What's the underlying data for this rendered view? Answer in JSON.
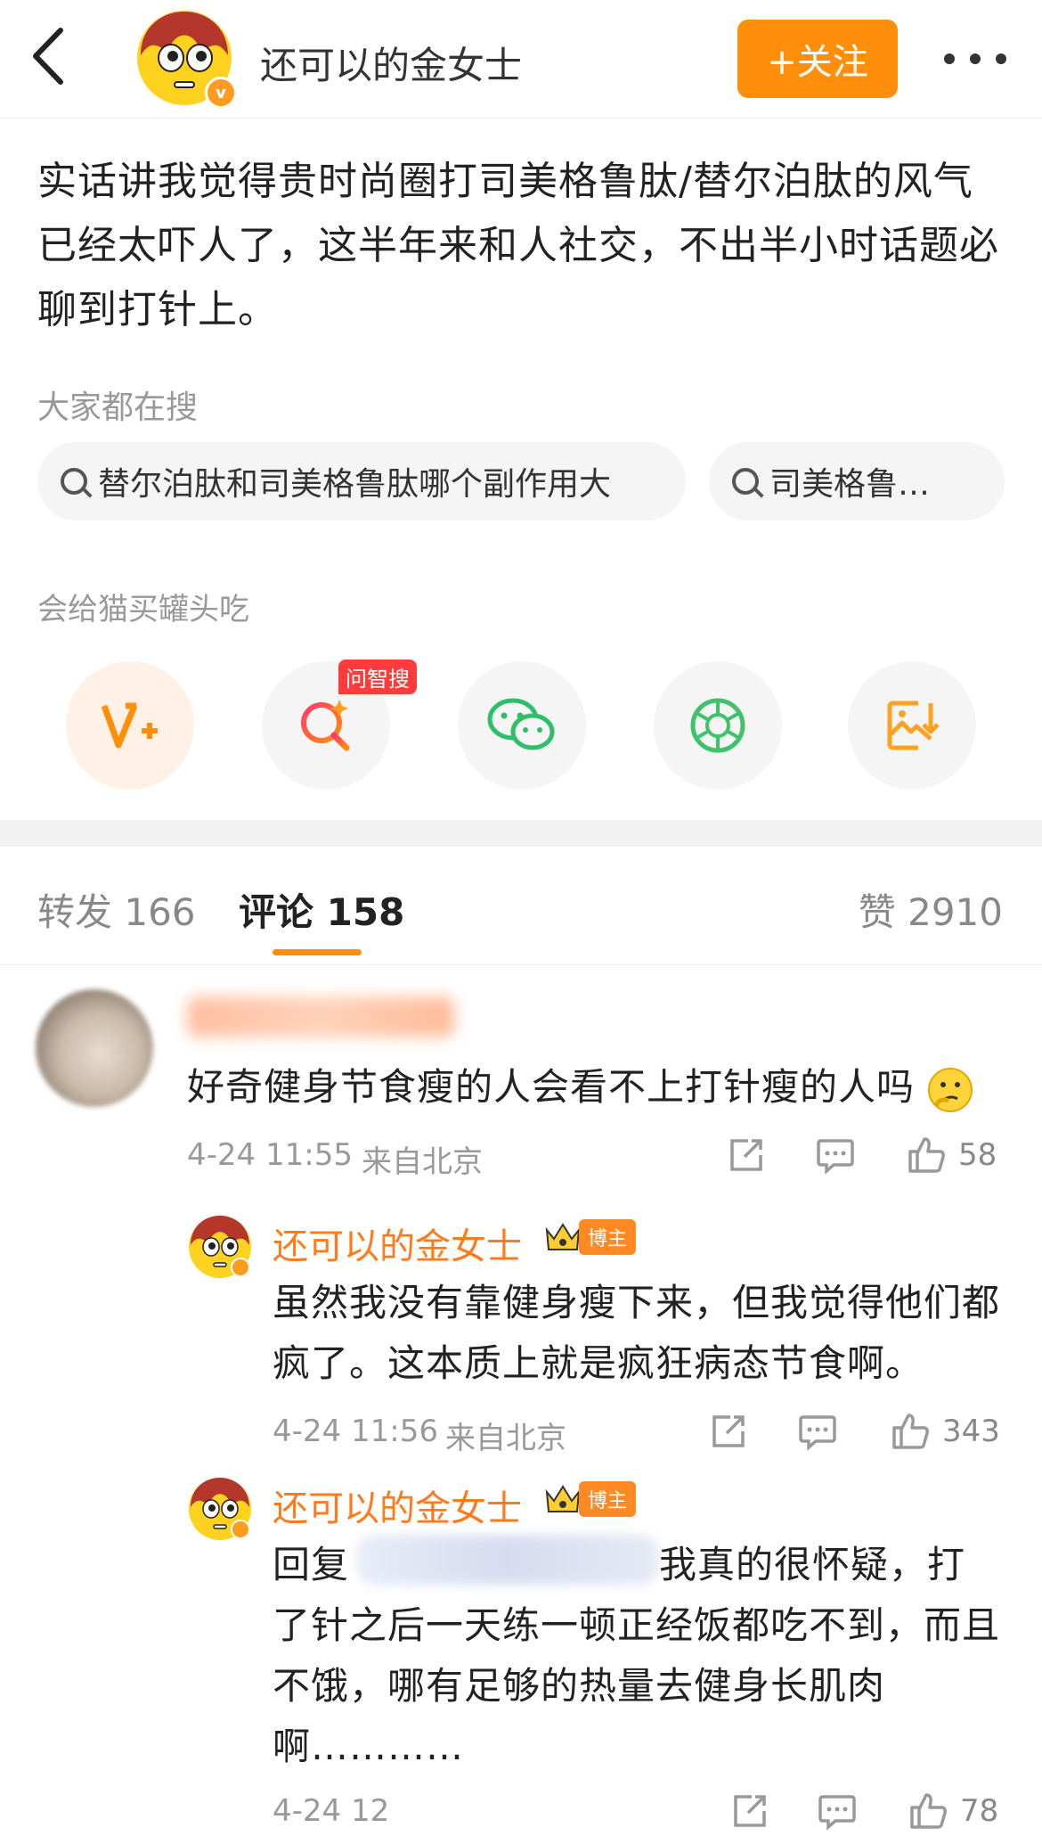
{
  "header": {
    "back_label": "<",
    "author_name": "还可以的金女士",
    "follow_label": "+关注",
    "verified_badge": "v"
  },
  "post": {
    "text": "实话讲我觉得贵时尚圈打司美格鲁肽/替尔泊肽的风气已经太吓人了，这半年来和人社交，不出半小时话题必聊到打针上。"
  },
  "search": {
    "title": "大家都在搜",
    "chips": [
      "替尔泊肽和司美格鲁肽哪个副作用大",
      "司美格鲁…"
    ]
  },
  "share": {
    "title": "会给猫买罐头吃",
    "hot_badge": "问智搜",
    "buttons": [
      "vplus-icon",
      "ai-search-icon",
      "wechat-icon",
      "moments-icon",
      "save-image-icon"
    ]
  },
  "tabs": {
    "repost": "转发 166",
    "comment": "评论 158",
    "like": "赞 2910"
  },
  "comments": [
    {
      "text": "好奇健身节食瘦的人会看不上打针瘦的人吗",
      "time": "4-24 11:55",
      "location": "来自北京",
      "likes": "58"
    }
  ],
  "replies": [
    {
      "name": "还可以的金女士",
      "badge": "博主",
      "text": "虽然我没有靠健身瘦下来，但我觉得他们都疯了。这本质上就是疯狂病态节食啊。",
      "time": "4-24 11:56",
      "location": "来自北京",
      "likes": "343"
    },
    {
      "name": "还可以的金女士",
      "badge": "博主",
      "text_prefix": "回复",
      "text": "我真的很怀疑，打了针之后一天练一顿正经饭都吃不到，而且不饿，哪有足够的热量去健身长肌肉啊…………",
      "time": "4-24 12",
      "likes": "78"
    }
  ],
  "colors": {
    "accent": "#ff8f0b",
    "name": "#ff7a1a",
    "muted": "#999999"
  }
}
